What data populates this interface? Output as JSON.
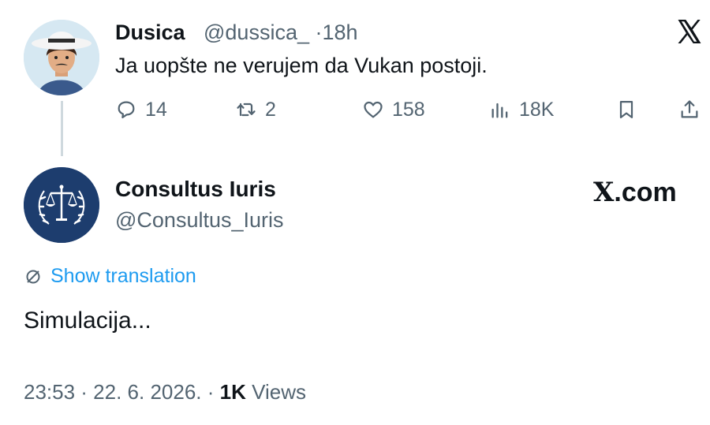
{
  "tweet": {
    "author_name": "Dusica",
    "handle": "@dussica_",
    "separator": "·",
    "time": "18h",
    "text": "Ja uopšte ne verujem da Vukan postoji.",
    "actions": {
      "replies": "14",
      "retweets": "2",
      "likes": "158",
      "views": "18K"
    }
  },
  "reply": {
    "author_name": "Consultus Iuris",
    "handle": "@Consultus_Iuris",
    "show_translation": "Show translation",
    "text": "Simulacija...",
    "timestamp": "23:53 · 22. 6. 2026. ·",
    "views_count": "1K",
    "views_label": "Views"
  },
  "brand": {
    "watermark": ".com",
    "logo_letter": "X"
  },
  "colors": {
    "link": "#1d9bf0",
    "secondary_text": "#536471",
    "primary_text": "#0f1419",
    "reply_avatar_bg": "#1d3d6e"
  },
  "icons": [
    "x-logo-icon",
    "reply-icon",
    "retweet-icon",
    "like-icon",
    "views-icon",
    "bookmark-icon",
    "share-icon",
    "translate-icon",
    "scales-of-justice-icon"
  ]
}
